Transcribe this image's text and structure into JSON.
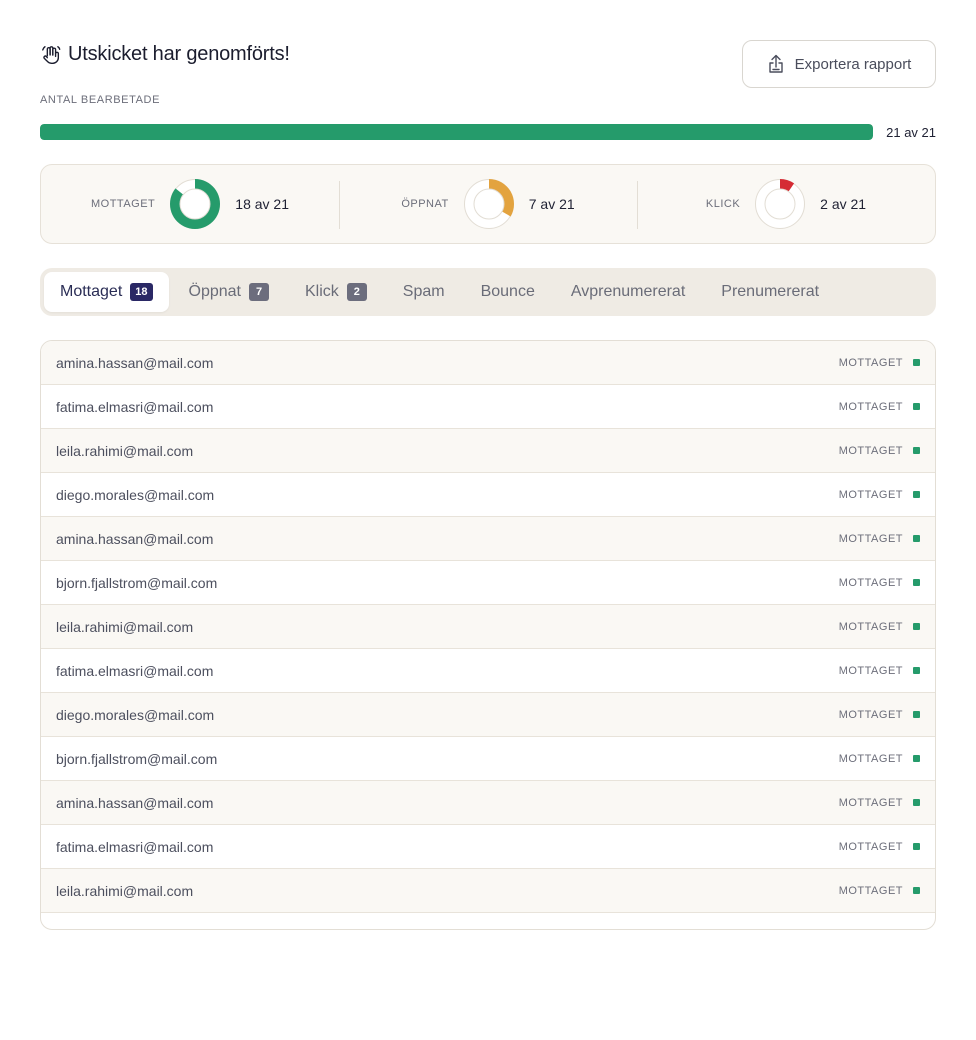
{
  "header": {
    "title": "Utskicket har genomförts!",
    "title_icon": "hand-wave-icon",
    "export_label": "Exportera rapport",
    "export_icon": "upload-icon"
  },
  "progress": {
    "label": "ANTAL BEARBETADE",
    "processed": 21,
    "total": 21,
    "text": "21 av 21",
    "color": "#259b6b"
  },
  "stats": [
    {
      "label": "MOTTAGET",
      "value_text": "18 av 21",
      "value": 18,
      "total": 21,
      "color": "#259b6b"
    },
    {
      "label": "ÖPPNAT",
      "value_text": "7 av 21",
      "value": 7,
      "total": 21,
      "color": "#e3a33f"
    },
    {
      "label": "KLICK",
      "value_text": "2 av 21",
      "value": 2,
      "total": 21,
      "color": "#d52b34"
    }
  ],
  "tabs": [
    {
      "label": "Mottaget",
      "badge": "18",
      "active": true
    },
    {
      "label": "Öppnat",
      "badge": "7"
    },
    {
      "label": "Klick",
      "badge": "2"
    },
    {
      "label": "Spam"
    },
    {
      "label": "Bounce"
    },
    {
      "label": "Avprenumererat"
    },
    {
      "label": "Prenumererat"
    }
  ],
  "recipients": [
    {
      "email": "amina.hassan@mail.com",
      "status": "MOTTAGET"
    },
    {
      "email": "fatima.elmasri@mail.com",
      "status": "MOTTAGET"
    },
    {
      "email": "leila.rahimi@mail.com",
      "status": "MOTTAGET"
    },
    {
      "email": "diego.morales@mail.com",
      "status": "MOTTAGET"
    },
    {
      "email": "amina.hassan@mail.com",
      "status": "MOTTAGET"
    },
    {
      "email": "bjorn.fjallstrom@mail.com",
      "status": "MOTTAGET"
    },
    {
      "email": "leila.rahimi@mail.com",
      "status": "MOTTAGET"
    },
    {
      "email": "fatima.elmasri@mail.com",
      "status": "MOTTAGET"
    },
    {
      "email": "diego.morales@mail.com",
      "status": "MOTTAGET"
    },
    {
      "email": "bjorn.fjallstrom@mail.com",
      "status": "MOTTAGET"
    },
    {
      "email": "amina.hassan@mail.com",
      "status": "MOTTAGET"
    },
    {
      "email": "fatima.elmasri@mail.com",
      "status": "MOTTAGET"
    },
    {
      "email": "leila.rahimi@mail.com",
      "status": "MOTTAGET"
    }
  ],
  "colors": {
    "accent_green": "#259b6b",
    "active_badge": "#2a2865"
  }
}
